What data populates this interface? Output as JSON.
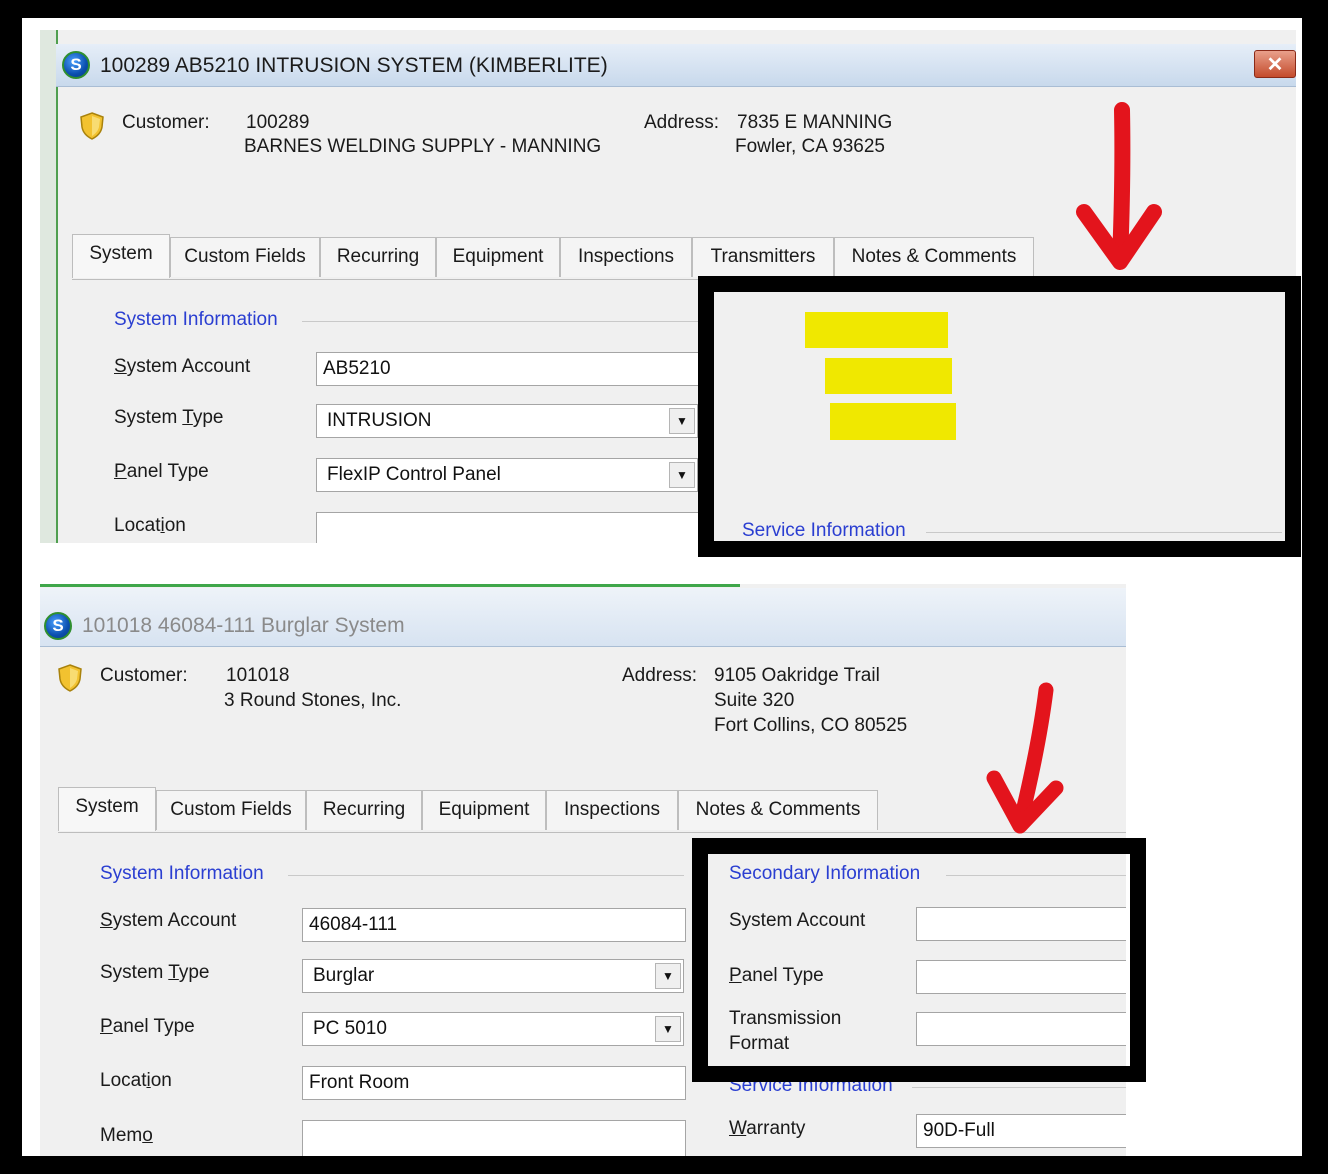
{
  "window1": {
    "title": "100289 AB5210  INTRUSION SYSTEM (KIMBERLITE)",
    "close_label": "✕",
    "customer_label": "Customer:",
    "customer_id": "100289",
    "customer_name": "BARNES WELDING SUPPLY - MANNING",
    "address_label": "Address:",
    "address_line1": "7835 E MANNING",
    "address_line2": "Fowler, CA  93625",
    "tabs": [
      "System",
      "Custom Fields",
      "Recurring",
      "Equipment",
      "Inspections",
      "Transmitters",
      "Notes & Comments"
    ],
    "section_system": "System Information",
    "system_account_label": "System Account",
    "system_account_value": "AB5210",
    "system_type_label": "System Type",
    "system_type_value": "INTRUSION",
    "panel_type_label": "Panel Type",
    "panel_type_value": "FlexIP Control Panel",
    "location_label": "Location",
    "section_service": "Service Information"
  },
  "window2": {
    "title": "101018 46084-111 Burglar System",
    "customer_label": "Customer:",
    "customer_id": "101018",
    "customer_name": "3 Round Stones, Inc.",
    "address_label": "Address:",
    "address_line1": "9105 Oakridge Trail",
    "address_line2": "Suite 320",
    "address_line3": "Fort Collins, CO  80525",
    "tabs": [
      "System",
      "Custom Fields",
      "Recurring",
      "Equipment",
      "Inspections",
      "Notes & Comments"
    ],
    "section_system": "System Information",
    "system_account_label": "System Account",
    "system_account_value": "46084-111",
    "system_type_label": "System Type",
    "system_type_value": "Burglar",
    "panel_type_label": "Panel Type",
    "panel_type_value": "PC 5010",
    "location_label": "Location",
    "location_value": "Front Room",
    "memo_label": "Memo",
    "section_secondary": "Secondary Information",
    "sec_system_account_label": "System Account",
    "sec_panel_type_label": "Panel Type",
    "sec_transmission_label_1": "Transmission",
    "sec_transmission_label_2": "Format",
    "section_service": "Service Information",
    "warranty_label": "Warranty",
    "warranty_value": "90D-Full"
  },
  "annotations": {
    "arrow_color": "#e3141c",
    "highlight_color": "#f0e800",
    "frame_color": "#000000"
  }
}
